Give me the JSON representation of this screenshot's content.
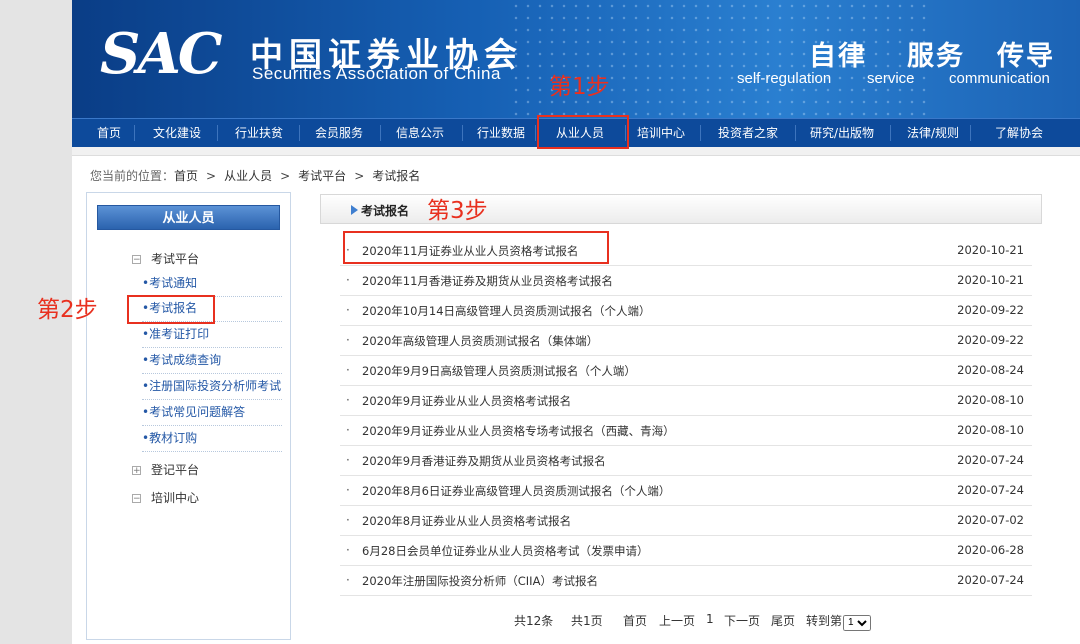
{
  "header": {
    "logo": "SAC",
    "cn_name": "中国证券业协会",
    "en_name": "Securities Association of China",
    "slogans": [
      {
        "cn": "自律",
        "en": "self-regulation"
      },
      {
        "cn": "服务",
        "en": "service"
      },
      {
        "cn": "传导",
        "en": "communication"
      }
    ]
  },
  "nav": [
    "首页",
    "文化建设",
    "行业扶贫",
    "会员服务",
    "信息公示",
    "行业数据",
    "从业人员",
    "培训中心",
    "投资者之家",
    "研究/出版物",
    "法律/规则",
    "了解协会"
  ],
  "breadcrumb": {
    "prefix": "您当前的位置：",
    "items": [
      "首页",
      "从业人员",
      "考试平台",
      "考试报名"
    ],
    "sep": ">"
  },
  "sidebar": {
    "title": "从业人员",
    "group1": {
      "toggle": "⊟",
      "label": "考试平台"
    },
    "items": [
      "•考试通知",
      "•考试报名",
      "•准考证打印",
      "•考试成绩查询",
      "•注册国际投资分析师考试",
      "•考试常见问题解答",
      "•教材订购"
    ],
    "group2": {
      "toggle": "⊞",
      "label": "登记平台"
    },
    "group3": {
      "toggle": "⊟",
      "label": "培训中心"
    }
  },
  "main": {
    "title": "考试报名",
    "bullet": "·",
    "rows": [
      {
        "title": "2020年11月证券业从业人员资格考试报名",
        "date": "2020-10-21"
      },
      {
        "title": "2020年11月香港证券及期货从业员资格考试报名",
        "date": "2020-10-21"
      },
      {
        "title": "2020年10月14日高级管理人员资质测试报名（个人端）",
        "date": "2020-09-22"
      },
      {
        "title": "2020年高级管理人员资质测试报名（集体端）",
        "date": "2020-09-22"
      },
      {
        "title": "2020年9月9日高级管理人员资质测试报名（个人端）",
        "date": "2020-08-24"
      },
      {
        "title": "2020年9月证券业从业人员资格考试报名",
        "date": "2020-08-10"
      },
      {
        "title": "2020年9月证券业从业人员资格专场考试报名（西藏、青海）",
        "date": "2020-08-10"
      },
      {
        "title": "2020年9月香港证券及期货从业员资格考试报名",
        "date": "2020-07-24"
      },
      {
        "title": "2020年8月6日证券业高级管理人员资质测试报名（个人端）",
        "date": "2020-07-24"
      },
      {
        "title": "2020年8月证券业从业人员资格考试报名",
        "date": "2020-07-02"
      },
      {
        "title": "6月28日会员单位证券业从业人员资格考试（发票申请）",
        "date": "2020-06-28"
      },
      {
        "title": "2020年注册国际投资分析师（CIIA）考试报名",
        "date": "2020-07-24"
      }
    ]
  },
  "pager": {
    "total": "共12条",
    "pages": "共1页",
    "first": "首页",
    "prev": "上一页",
    "current": "1",
    "next": "下一页",
    "last": "尾页",
    "goto_prefix": "转到第",
    "goto_value": "1"
  },
  "annotations": {
    "step1": "第1步",
    "step2": "第2步",
    "step3": "第3步"
  },
  "colors": {
    "nav_bg": "#0d4a9b",
    "annotation": "#e8301f",
    "link": "#2458a6"
  }
}
